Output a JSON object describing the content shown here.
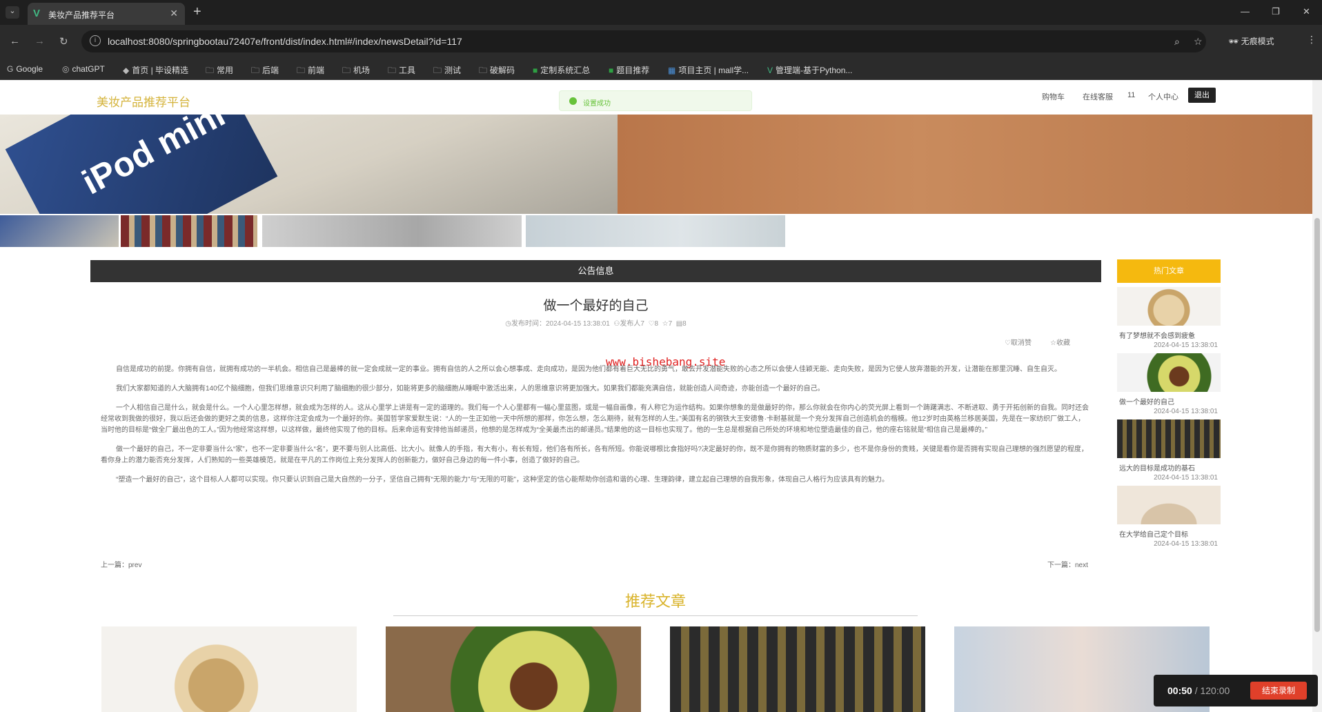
{
  "browser": {
    "tab_title": "美妆产品推荐平台",
    "url": "localhost:8080/springbootau72407e/front/dist/index.html#/index/newsDetail?id=117",
    "incognito_label": "无痕模式",
    "bookmarks": [
      "Google",
      "chatGPT",
      "首页 | 毕设精选",
      "常用",
      "后端",
      "前端",
      "机场",
      "工具",
      "测试",
      "破解码",
      "定制系统汇总",
      "题目推荐",
      "项目主页 | mall学...",
      "管理端-基于Python..."
    ]
  },
  "header": {
    "logo": "美妆产品推荐平台",
    "toast": "设置成功",
    "links": [
      "购物车",
      "在线客服",
      "11",
      "个人中心"
    ],
    "logout": "退出"
  },
  "banner": {
    "text": "iPod mini"
  },
  "article": {
    "section_title": "公告信息",
    "title": "做一个最好的自己",
    "meta_time": "发布时间：2024-04-15 13:38:01",
    "meta_author": "发布人7",
    "meta_likes": "8",
    "meta_favs": "7",
    "meta_views": "8",
    "action_unlike": "取消赞",
    "action_fav": "收藏",
    "watermark": "www.bishebang.site",
    "paragraphs": [
      "自信是成功的前提。你拥有自信，就拥有成功的一半机会。相信自己是最棒的就一定会成就一定的事业。拥有自信的人之所以会心想事成、走向成功，是因为他们都有着巨大无比的勇气，敢去开发潜能失败的心态之所以会使人佳颖无能、走向失败，是因为它使人放弃潜能的开发，让潜能在那里沉睡、自生自灭。",
      "我们大家都知道的人大脑拥有140亿个脑细胞，但我们思维意识只利用了脑细胞的很少部分，如能将更多的脑细胞从睡眠中激活出来，人的思维意识将更加强大。如果我们都能充满自信，就能创造人间奇迹，亦能创造一个最好的自己。",
      "一个人相信自己是什么，就会是什么。一个人心里怎样想，就会成为怎样的人。这从心里学上讲是有一定的道理的。我们每一个人心里都有一幅心里蓝图，或是一幅自画像，有人称它为运作结构。如果你想象的是做最好的你，那么你就会在你内心的荧光屏上看到一个踌躇满志、不断进取、勇于开拓创新的自我。同时还会经常收到我做的很好，我以后还会做的更好之类的信息，这样你注定会成为一个最好的你。美国哲学家爱默生说：“人的一生正如他一天中所想的那样，你怎么想，怎么期待，就有怎样的人生。”美国有名的钢铁大王安德鲁·卡耐基就是一个充分发挥自己创造机会的楷模。他12岁时由英格兰移居美国，先是在一家纺织厂做工人，当时他的目标是“做全厂最出色的工人。”因为他经常这样想，以这样做，最终他实现了他的目标。后来命运有安排他当邮递员，他想的是怎样成为“全美最杰出的邮递员。”结果他的这一目标也实现了。他的一生总是根据自己所处的环境和地位塑造最佳的自己，他的座右铭就是“相信自己是最棒的。”",
      "做一个最好的自己，不一定非要当什么“家”，也不一定非要当什么“名”，更不要与别人比高低、比大小。就像人的手指，有大有小，有长有短，他们各有所长，各有所短。你能说哪根比食指好吗?决定最好的你，既不是你拥有的物质财富的多少，也不是你身份的贵贱，关键是看你是否拥有实现自己理想的强烈愿望的程度，看你身上的潜力能否充分发挥，人们熟知的一些英雄模范，就是在平凡的工作岗位上充分发挥人的创新能力，做好自己身边的每一件小事，创造了做好的自己。",
      "“塑造一个最好的自己”，这个目标人人都可以实现。你只要认识到自己是大自然的一分子，坚信自己拥有“无限的能力”与“无限的可能”，这种坚定的信心能帮助你创造和谐的心理、生理韵律，建立起自己理想的自我形象，体现自己人格行为应该具有的魅力。"
    ],
    "prev_label": "上一篇：",
    "prev_value": "prev",
    "next_label": "下一篇：",
    "next_value": "next"
  },
  "hot": {
    "title": "热门文章",
    "items": [
      {
        "name": "有了梦想就不会感到疲惫",
        "date": "2024-04-15 13:38:01"
      },
      {
        "name": "做一个最好的自己",
        "date": "2024-04-15 13:38:01"
      },
      {
        "name": "远大的目标是成功的基石",
        "date": "2024-04-15 13:38:01"
      },
      {
        "name": "在大学给自己定个目标",
        "date": "2024-04-15 13:38:01"
      }
    ]
  },
  "recommend": {
    "title": "推荐文章"
  },
  "recorder": {
    "elapsed": "00:50",
    "total": " / 120:00",
    "stop": "结束录制"
  }
}
